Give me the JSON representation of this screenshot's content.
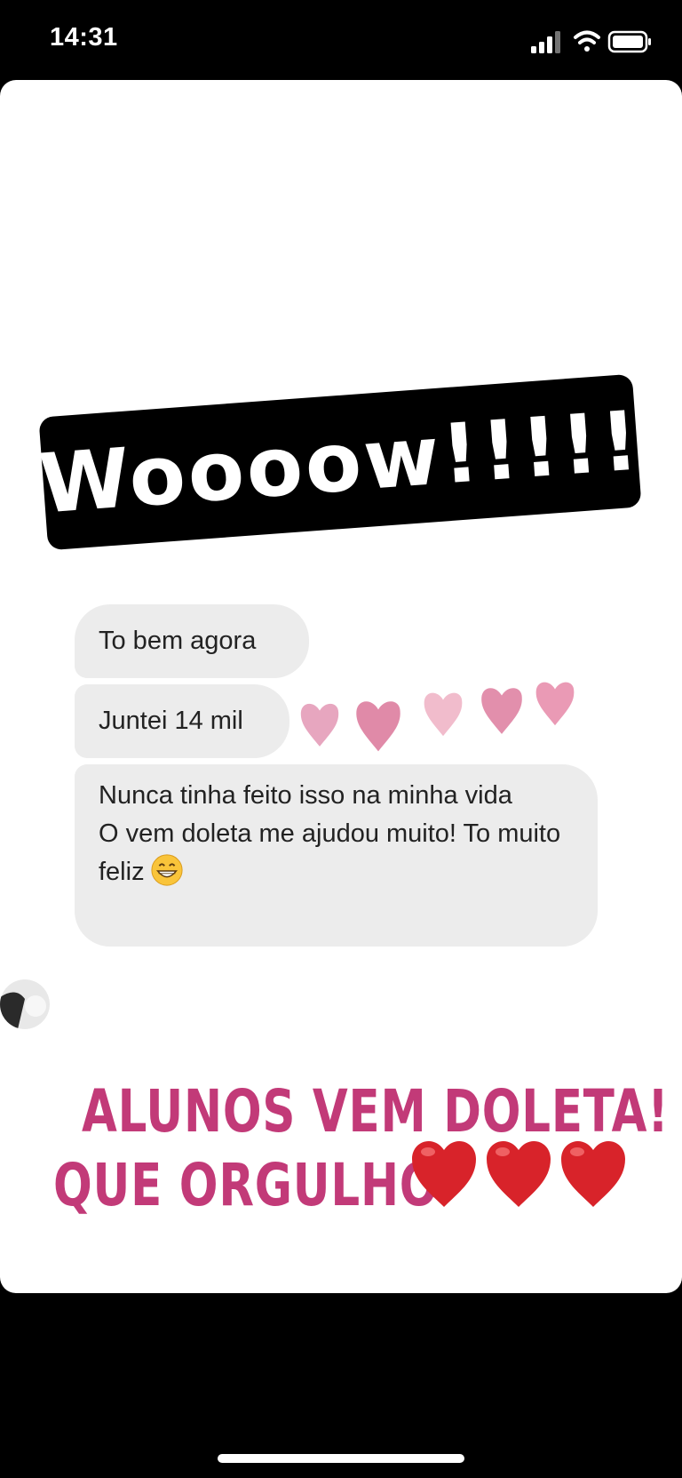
{
  "status_bar": {
    "time": "14:31",
    "icons": [
      "cellular-signal-icon",
      "wifi-icon",
      "battery-icon"
    ]
  },
  "sticker": {
    "text": "Woooow!!!!!",
    "background": "#000000",
    "color": "#ffffff"
  },
  "chat": {
    "messages": [
      {
        "text": "To bem agora"
      },
      {
        "text": "Juntei 14 mil"
      },
      {
        "lines": [
          "Nunca tinha feito isso na minha vida",
          "O vem doleta me ajudou muito! To muito feliz"
        ],
        "emoji": "grinning-face-icon"
      }
    ],
    "bubble_color": "#ececec"
  },
  "caption": {
    "line1": "ALUNOS VEM DOLETA!",
    "line2": "QUE ORGULHO",
    "color": "#c23a78",
    "hearts": [
      "red-heart-icon",
      "red-heart-icon",
      "red-heart-icon"
    ]
  },
  "decor": {
    "pink_hearts": 5,
    "heart_color": "#e07fa0"
  }
}
